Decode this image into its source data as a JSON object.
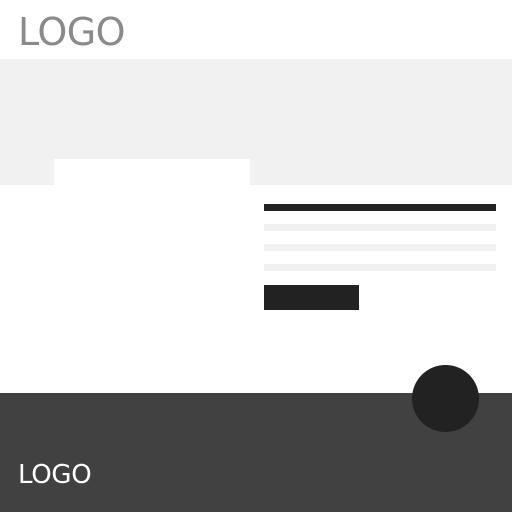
{
  "header": {
    "logo_text": "LOGO"
  },
  "footer": {
    "logo_text": "LOGO"
  },
  "colors": {
    "page_background": "#ffffff",
    "hero_background": "#f1f1f1",
    "placeholder_line": "#f1f1f1",
    "dark_accent": "#222222",
    "footer_background": "#414141",
    "header_logo_text": "#8a8a8a",
    "footer_logo_text": "#ffffff"
  }
}
